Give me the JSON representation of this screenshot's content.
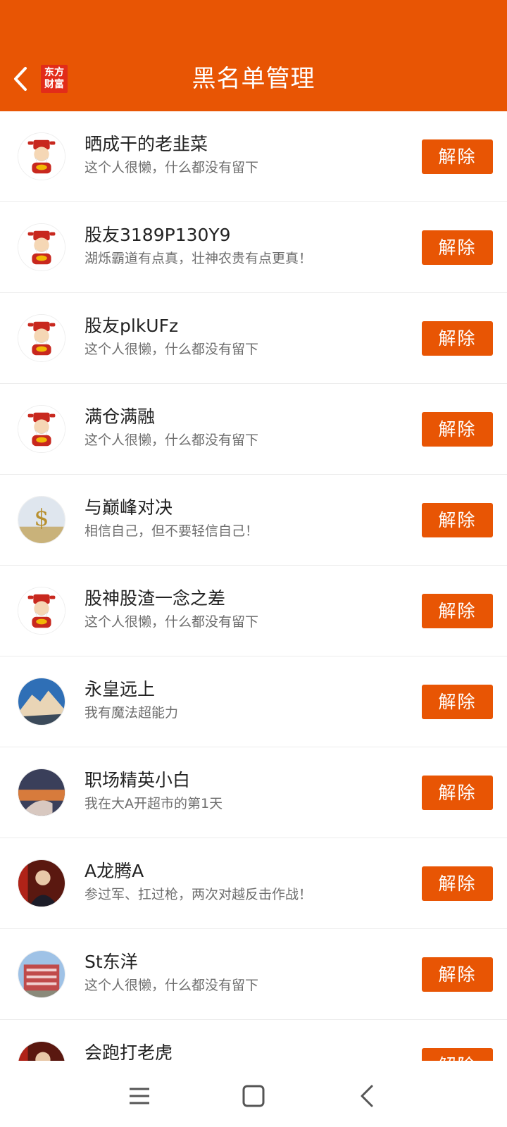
{
  "header": {
    "title": "黑名单管理",
    "logo_line1": "东方",
    "logo_line2": "财富",
    "back_icon": "chevron-left-icon",
    "accent": "#E85504"
  },
  "blacklist": [
    {
      "name": "晒成干的老韭菜",
      "signature": "这个人很懒，什么都没有留下",
      "button": "解除",
      "avatar": "fortune-god"
    },
    {
      "name": "股友3189P130Y9",
      "signature": "湖烁霸道有点真，壮神农贵有点更真！",
      "button": "解除",
      "avatar": "fortune-god"
    },
    {
      "name": "股友plkUFz",
      "signature": "这个人很懒，什么都没有留下",
      "button": "解除",
      "avatar": "fortune-god"
    },
    {
      "name": "满仓满融",
      "signature": "这个人很懒，什么都没有留下",
      "button": "解除",
      "avatar": "fortune-god"
    },
    {
      "name": "与巅峰对决",
      "signature": "相信自己，但不要轻信自己！",
      "button": "解除",
      "avatar": "dollar"
    },
    {
      "name": "股神股渣一念之差",
      "signature": "这个人很懒，什么都没有留下",
      "button": "解除",
      "avatar": "fortune-god"
    },
    {
      "name": "永皇远上",
      "signature": "我有魔法超能力",
      "button": "解除",
      "avatar": "mountain"
    },
    {
      "name": "职场精英小白",
      "signature": "我在大A开超市的第1天",
      "button": "解除",
      "avatar": "sunset"
    },
    {
      "name": "A龙腾A",
      "signature": "参过军、扛过枪，两次对越反击作战！",
      "button": "解除",
      "avatar": "portrait"
    },
    {
      "name": "St东洋",
      "signature": "这个人很懒，什么都没有留下",
      "button": "解除",
      "avatar": "building"
    },
    {
      "name": "会跑打老虎",
      "signature": "",
      "button": "解除",
      "avatar": "portrait"
    }
  ],
  "navbar": {
    "menu_icon": "menu-icon",
    "home_icon": "home-square-icon",
    "back_icon": "back-triangle-icon"
  }
}
